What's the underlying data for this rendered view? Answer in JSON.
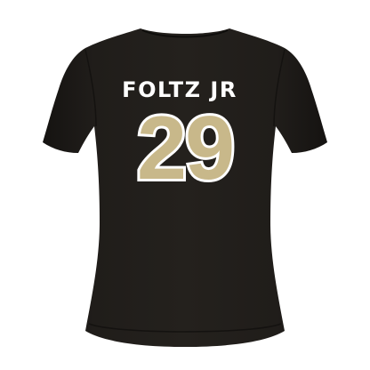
{
  "product": {
    "player_name": "FOLTZ JR",
    "player_number": "29"
  },
  "colors": {
    "background": "#ffffff",
    "shirt": "#1e1b18",
    "shirt_shadow": "#141210",
    "number_fill": "#c8b88a",
    "number_outline": "#ffffff",
    "name_text": "#ffffff"
  }
}
